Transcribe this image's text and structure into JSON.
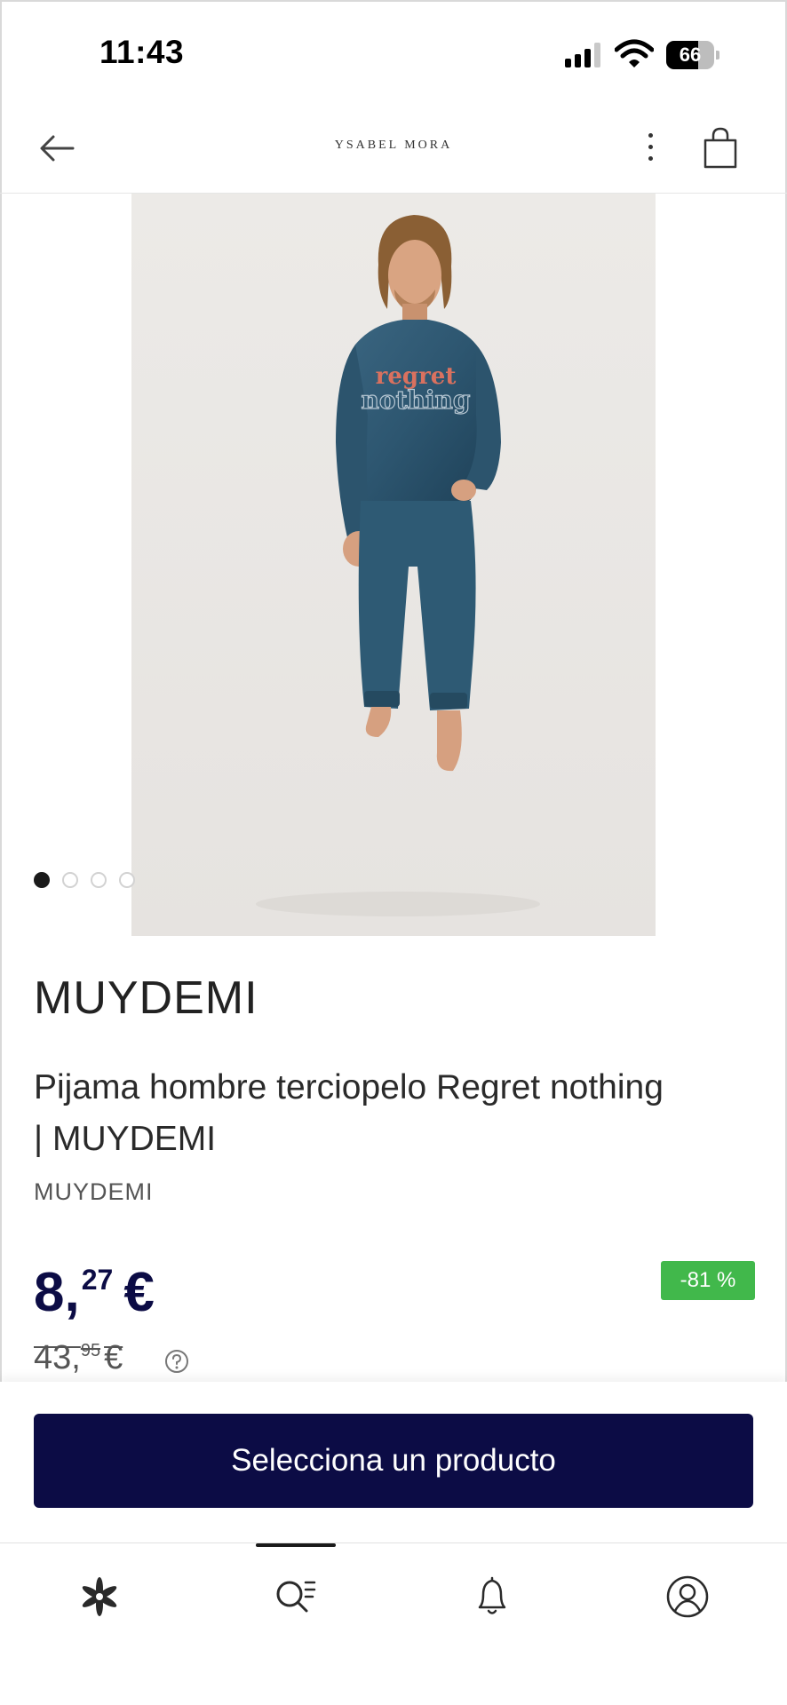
{
  "status_bar": {
    "time": "11:43",
    "battery": "66",
    "battery_level": 0.66
  },
  "header": {
    "brand": "YSABEL MORA",
    "back_icon": "arrow-left-icon",
    "more_icon": "more-vertical-icon",
    "bag_icon": "shopping-bag-icon"
  },
  "gallery": {
    "image_count": 4,
    "active_index": 0
  },
  "product": {
    "brand": "MUYDEMI",
    "title": "Pijama hombre terciopelo Regret nothing | MUYDEMI",
    "vendor": "MUYDEMI",
    "print_line1": "regret",
    "print_line2": "nothing",
    "price": {
      "int": "8,",
      "dec": "27",
      "currency": "€"
    },
    "old_price": {
      "int": "43,",
      "dec": "95",
      "currency": "€"
    },
    "discount": "-81 %"
  },
  "cta": {
    "label": "Selecciona un producto"
  },
  "bottom_nav": {
    "items": [
      {
        "icon": "flower-icon",
        "active": false
      },
      {
        "icon": "search-list-icon",
        "active": true
      },
      {
        "icon": "bell-icon",
        "active": false
      },
      {
        "icon": "user-circle-icon",
        "active": false
      }
    ]
  },
  "colors": {
    "primary": "#0c0c45",
    "discount": "#41b84b",
    "pajama": "#2e5670"
  }
}
